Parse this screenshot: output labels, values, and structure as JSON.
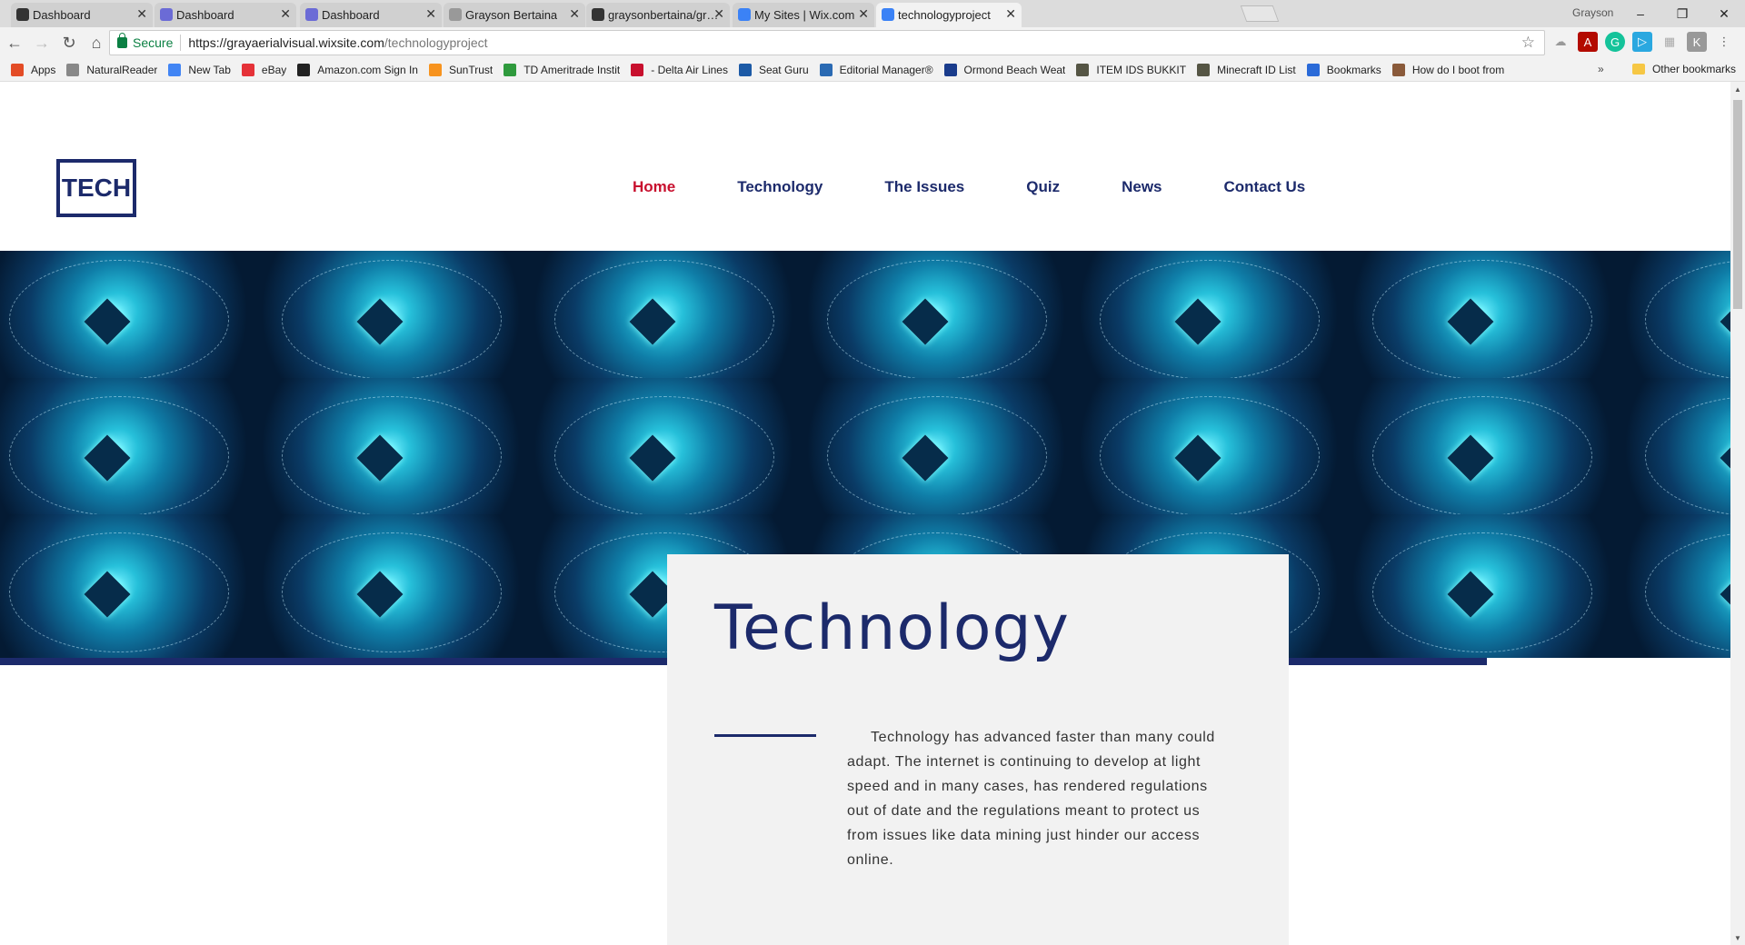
{
  "browser": {
    "tabs": [
      {
        "title": "Dashboard",
        "icon": "github-icon",
        "color": "#333333",
        "active": false
      },
      {
        "title": "Dashboard",
        "icon": "s-icon",
        "color": "#6b6bd6",
        "active": false
      },
      {
        "title": "Dashboard",
        "icon": "s-icon",
        "color": "#6b6bd6",
        "active": false
      },
      {
        "title": "Grayson Bertaina",
        "icon": "page-icon",
        "color": "#999999",
        "active": false
      },
      {
        "title": "graysonbertaina/grayson",
        "icon": "github-icon",
        "color": "#333333",
        "active": false
      },
      {
        "title": "My Sites | Wix.com",
        "icon": "wix-icon",
        "color": "#3b82f6",
        "active": false
      },
      {
        "title": "technologyproject",
        "icon": "wix-icon",
        "color": "#3b82f6",
        "active": true
      }
    ],
    "profile_name": "Grayson",
    "window_buttons": {
      "minimize": "–",
      "restore": "❐",
      "close": "✕"
    },
    "address": {
      "secure_label": "Secure",
      "url_host": "https://grayaerialvisual.wixsite.com",
      "url_path": "/technologyproject"
    },
    "bookmarks": [
      {
        "label": "Apps",
        "icon": "apps-icon",
        "color": "#e34c26"
      },
      {
        "label": "NaturalReader",
        "icon": "page-icon",
        "color": "#888888"
      },
      {
        "label": "New Tab",
        "icon": "google-icon",
        "color": "#4285f4"
      },
      {
        "label": "eBay",
        "icon": "ebay-icon",
        "color": "#e53238"
      },
      {
        "label": "Amazon.com Sign In",
        "icon": "amazon-icon",
        "color": "#222222"
      },
      {
        "label": "SunTrust",
        "icon": "suntrust-icon",
        "color": "#f7931e"
      },
      {
        "label": "TD Ameritrade Instit",
        "icon": "td-icon",
        "color": "#2f9a3d"
      },
      {
        "label": "- Delta Air Lines",
        "icon": "delta-icon",
        "color": "#c8102e"
      },
      {
        "label": "Seat Guru",
        "icon": "seatguru-icon",
        "color": "#1c5aa6"
      },
      {
        "label": "Editorial Manager®",
        "icon": "editorial-icon",
        "color": "#2a6ab3"
      },
      {
        "label": "Ormond Beach Weat",
        "icon": "weather-icon",
        "color": "#1a3c8c"
      },
      {
        "label": "ITEM IDS BUKKIT",
        "icon": "minecraft-icon",
        "color": "#555544"
      },
      {
        "label": "Minecraft ID List",
        "icon": "minecraft-icon",
        "color": "#555544"
      },
      {
        "label": "Bookmarks",
        "icon": "star-icon",
        "color": "#2a6ad8"
      },
      {
        "label": "How do I boot from",
        "icon": "avatar-icon",
        "color": "#8a5a3a"
      }
    ],
    "bookmarks_more": "»",
    "other_bookmarks": "Other bookmarks"
  },
  "site": {
    "logo_text": "TECH",
    "nav": [
      {
        "label": "Home",
        "active": true
      },
      {
        "label": "Technology",
        "active": false
      },
      {
        "label": "The Issues",
        "active": false
      },
      {
        "label": "Quiz",
        "active": false
      },
      {
        "label": "News",
        "active": false
      },
      {
        "label": "Contact Us",
        "active": false
      }
    ],
    "card": {
      "title": "Technology",
      "body": "Technology has advanced faster than many could adapt. The internet is continuing to develop at light speed and in many cases, has rendered regulations out of date and the regulations meant to protect us from issues like data mining just hinder our access online."
    }
  },
  "colors": {
    "brand_navy": "#1c2a6b",
    "nav_active": "#c8102e",
    "card_bg": "#f2f2f2"
  }
}
